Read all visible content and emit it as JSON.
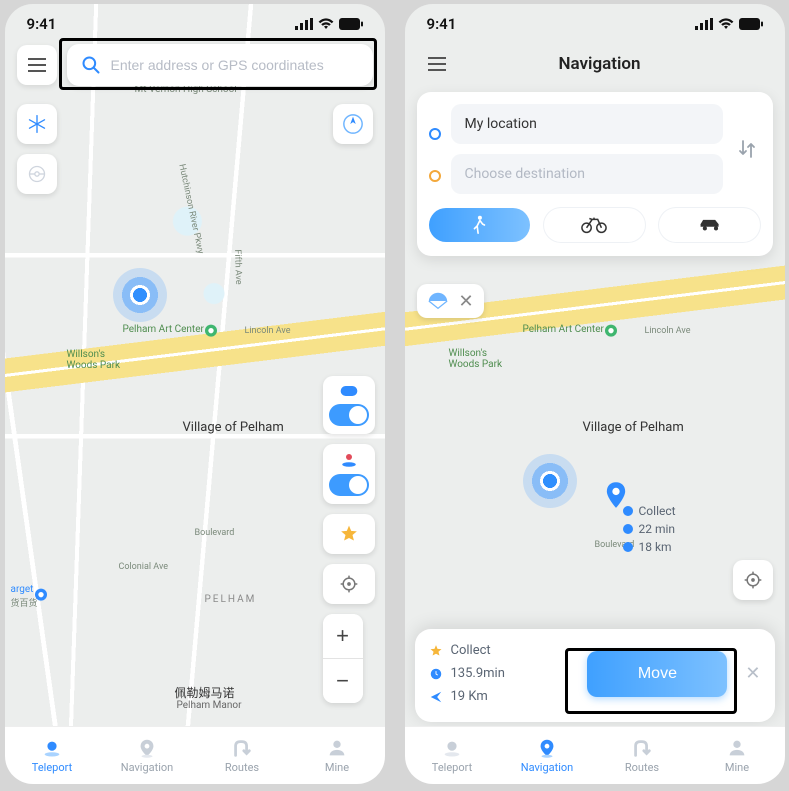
{
  "status": {
    "time": "9:41"
  },
  "left": {
    "search_placeholder": "Enter address or GPS coordinates",
    "map": {
      "park1": "Willson's Woods Park",
      "poi1": "Pelham Art Center",
      "street1": "Lincoln Ave",
      "village": "Village of Pelham",
      "blvd": "Boulevard",
      "colonial": "Colonial Ave",
      "pelham_caps": "PELHAM",
      "cjk": "佩勒姆马诺",
      "manor": "Pelham Manor",
      "ave5": "Fifth Ave",
      "river_pkwy": "Hutchinson River Pkwy",
      "highschool": "Mt Vernon High School",
      "arget": "arget",
      "arget_cjk": "货百货"
    }
  },
  "right": {
    "title": "Navigation",
    "from_label": "My location",
    "to_placeholder": "Choose destination",
    "dest": {
      "collect": "Collect",
      "time": "22 min",
      "dist": "18 km"
    },
    "sheet": {
      "collect": "Collect",
      "time": "135.9min",
      "dist": "19 Km",
      "move": "Move"
    }
  },
  "tabs": {
    "teleport": "Teleport",
    "navigation": "Navigation",
    "routes": "Routes",
    "mine": "Mine"
  }
}
